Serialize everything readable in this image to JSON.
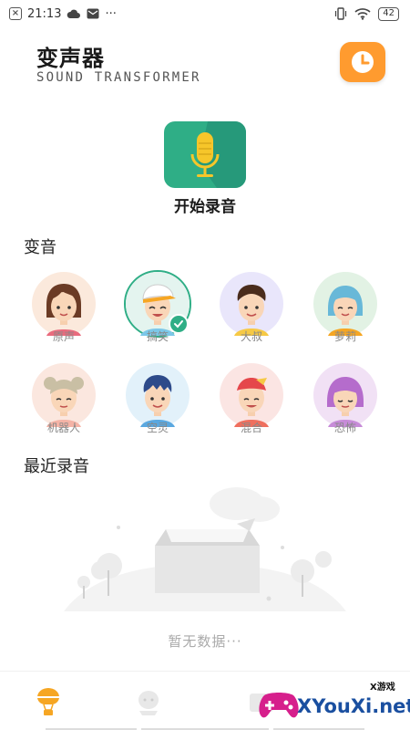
{
  "status_bar": {
    "time": "21:13",
    "more": "···",
    "battery": "42"
  },
  "header": {
    "title": "变声器",
    "subtitle": "SOUND TRANSFORMER",
    "history_icon": "clock-icon"
  },
  "record": {
    "label": "开始录音",
    "icon": "microphone-icon"
  },
  "voice_section": {
    "title": "变音",
    "selected": "搞笑",
    "items": [
      {
        "label": "原声"
      },
      {
        "label": "搞笑"
      },
      {
        "label": "大叔"
      },
      {
        "label": "萝莉"
      },
      {
        "label": "机器人"
      },
      {
        "label": "空灵"
      },
      {
        "label": "混合"
      },
      {
        "label": "恐怖"
      }
    ]
  },
  "recent_section": {
    "title": "最近录音",
    "empty_text": "暂无数据···"
  },
  "bottom_nav": {
    "items": [
      "balloon-icon",
      "character-icon",
      "tab-icon"
    ]
  },
  "watermark": {
    "brand": "XYouXi.net",
    "small": "X游戏"
  },
  "colors": {
    "accent": "#2fae86",
    "orange": "#ff9b2f"
  }
}
